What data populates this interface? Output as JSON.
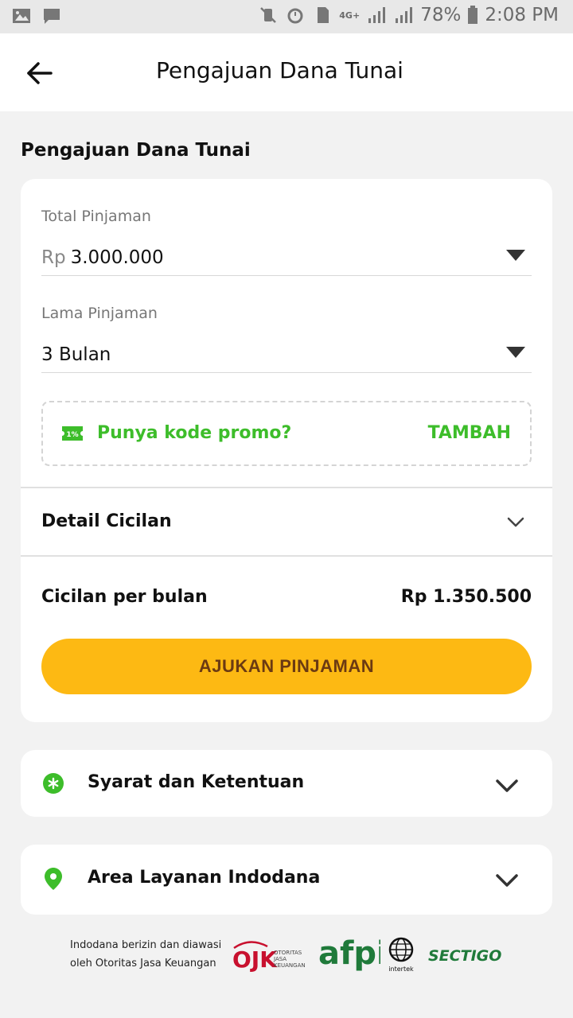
{
  "status_bar": {
    "battery": "78%",
    "time": "2:08 PM",
    "network": "4G+"
  },
  "app_bar": {
    "title": "Pengajuan Dana Tunai"
  },
  "section": {
    "title": "Pengajuan Dana Tunai"
  },
  "loan_form": {
    "amount_label": "Total Pinjaman",
    "amount_prefix": "Rp",
    "amount_value": "3.000.000",
    "duration_label": "Lama Pinjaman",
    "duration_value": "3 Bulan"
  },
  "promo": {
    "text": "Punya kode promo?",
    "action": "TAMBAH"
  },
  "detail": {
    "label": "Detail Cicilan"
  },
  "installment": {
    "label": "Cicilan per bulan",
    "value": "Rp 1.350.500"
  },
  "cta": {
    "label": "AJUKAN PINJAMAN"
  },
  "accordions": [
    {
      "label": "Syarat dan Ketentuan",
      "icon": "asterisk-circle-icon"
    },
    {
      "label": "Area Layanan Indodana",
      "icon": "location-pin-icon"
    }
  ],
  "footer": {
    "line1": "Indodana berizin dan diawasi",
    "line2": "oleh Otoritas Jasa Keuangan",
    "ojk_logo": "OJK",
    "ojk_caption_1": "OTORITAS",
    "ojk_caption_2": "JASA",
    "ojk_caption_3": "KEUANGAN",
    "afpi_logo": "afpi",
    "intertek_caption": "intertek",
    "sectigo_logo": "SECTIGO"
  },
  "colors": {
    "accent_green": "#3dbd2a",
    "cta_yellow": "#fdb913",
    "cta_text": "#6b3a12",
    "ojk_red": "#c8102e",
    "afpi_green": "#1f7a3a"
  }
}
